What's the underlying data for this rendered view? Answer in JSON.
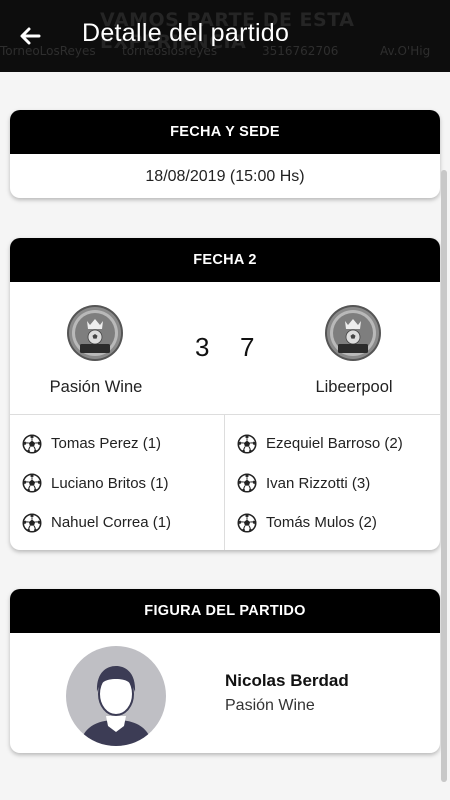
{
  "header": {
    "title": "Detalle del partido",
    "banner": {
      "headline": "VAMOS PARTE DE ESTA EXPERIENCIA",
      "facebook": "TorneoLosReyes",
      "instagram": "torneoslosreyes",
      "phone": "3516762706",
      "address": "Av.O'Hig"
    }
  },
  "venue_card": {
    "title": "FECHA Y SEDE",
    "datetime": "18/08/2019 (15:00 Hs)"
  },
  "match_card": {
    "title": "FECHA 2",
    "home": {
      "name": "Pasión Wine",
      "score": "3",
      "crest_text": [
        "TORNEO",
        "LOS REYES"
      ],
      "scorers": [
        "Tomas Perez (1)",
        "Luciano Britos (1)",
        "Nahuel Correa (1)"
      ]
    },
    "away": {
      "name": "Libeerpool",
      "score": "7",
      "crest_text": [
        "TORNEO",
        "LOS REYES"
      ],
      "scorers": [
        "Ezequiel Barroso (2)",
        "Ivan Rizzotti (3)",
        "Tomás Mulos (2)"
      ]
    }
  },
  "mvp_card": {
    "title": "FIGURA DEL PARTIDO",
    "player_name": "Nicolas Berdad",
    "player_team": "Pasión Wine"
  },
  "colors": {
    "appbar": "#0d0d0d",
    "card_header": "#000000",
    "background": "#f5f5f5"
  },
  "icons": {
    "back": "arrow-left-icon",
    "scorer": "soccer-ball-icon",
    "crest": "team-crest-icon",
    "avatar": "user-avatar-icon"
  }
}
